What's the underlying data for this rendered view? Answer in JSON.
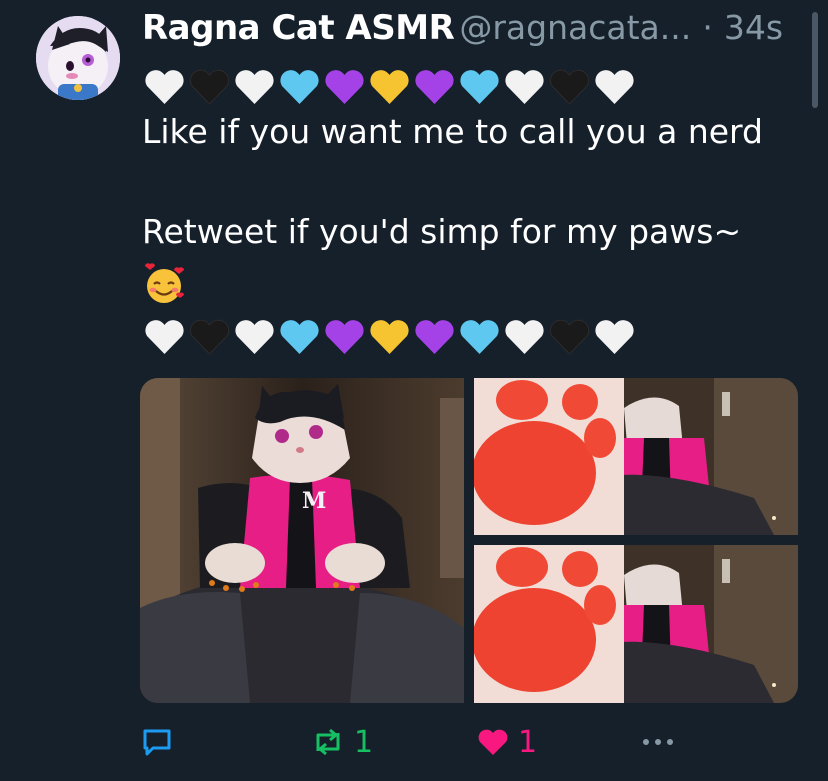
{
  "tweet": {
    "display_name": "Ragna Cat ASMR",
    "handle": "@ragnacata...",
    "separator": "·",
    "time": "34s",
    "line1": "Like if you want me to call you a nerd",
    "line2": "Retweet if you'd simp for my paws~",
    "heart_sequence": [
      "white",
      "black",
      "white",
      "blue",
      "purple",
      "yellow",
      "purple",
      "blue",
      "white",
      "black",
      "white"
    ]
  },
  "colors": {
    "background": "#15202b",
    "muted": "#8899a6",
    "reply": "#1d9bf0",
    "retweet": "#17bf63",
    "like": "#f91880",
    "heart_white": "#f2f2f2",
    "heart_black": "#1a1a1a",
    "heart_blue": "#5ec8f0",
    "heart_purple": "#a442e8",
    "heart_yellow": "#f6c431"
  },
  "actions": {
    "reply_icon": "comment-icon",
    "retweet_icon": "retweet-icon",
    "retweet_count": "1",
    "like_icon": "heart-filled-icon",
    "like_count": "1",
    "more_icon": "more-dots-icon"
  }
}
